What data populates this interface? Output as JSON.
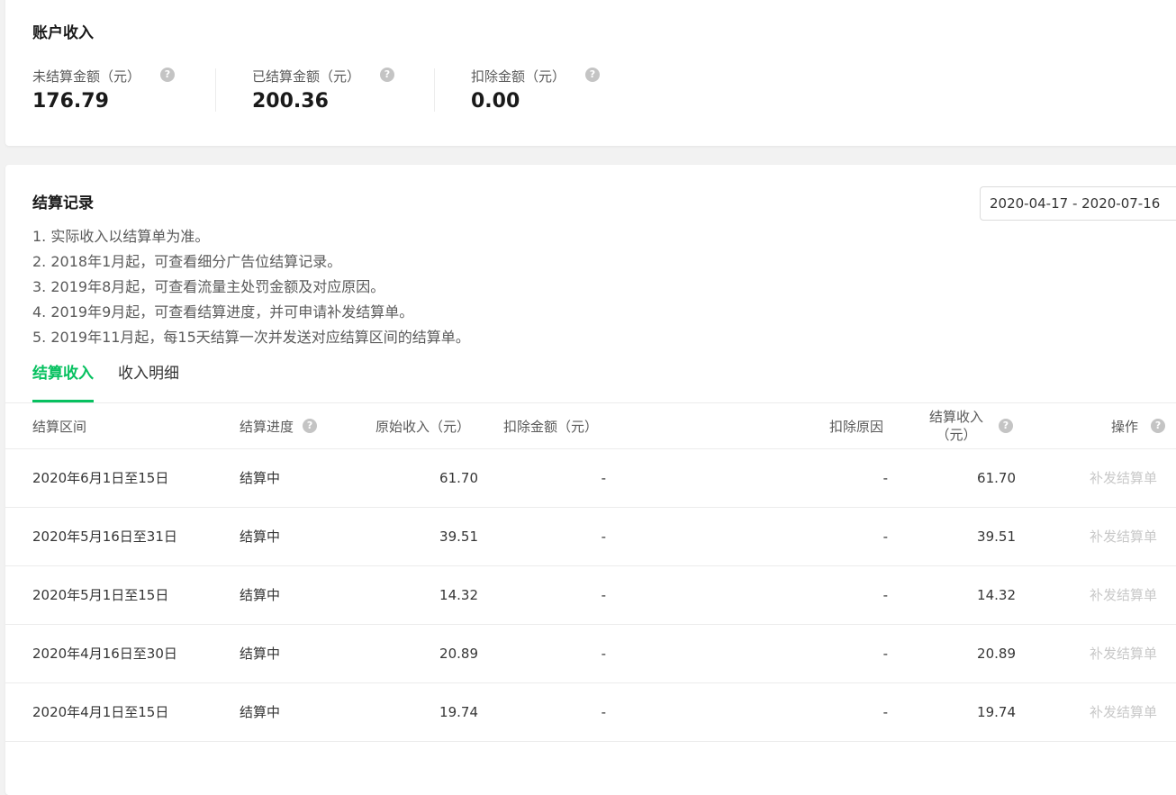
{
  "account": {
    "title": "账户收入",
    "metrics": [
      {
        "label": "未结算金额（元）",
        "value": "176.79"
      },
      {
        "label": "已结算金额（元）",
        "value": "200.36"
      },
      {
        "label": "扣除金额（元）",
        "value": "0.00"
      }
    ]
  },
  "settlement": {
    "title": "结算记录",
    "date_range": "2020-04-17 - 2020-07-16",
    "notes": [
      "1. 实际收入以结算单为准。",
      "2. 2018年1月起，可查看细分广告位结算记录。",
      "3. 2019年8月起，可查看流量主处罚金额及对应原因。",
      "4. 2019年9月起，可查看结算进度，并可申请补发结算单。",
      "5. 2019年11月起，每15天结算一次并发送对应结算区间的结算单。"
    ],
    "tabs": [
      {
        "label": "结算收入",
        "active": true
      },
      {
        "label": "收入明细",
        "active": false
      }
    ],
    "columns": {
      "period": "结算区间",
      "progress": "结算进度",
      "original": "原始收入（元）",
      "deduction": "扣除金额（元）",
      "reason": "扣除原因",
      "income_line1": "结算收入",
      "income_line2": "（元）",
      "action": "操作"
    },
    "rows": [
      {
        "period": "2020年6月1日至15日",
        "progress": "结算中",
        "original": "61.70",
        "deduction": "-",
        "reason": "-",
        "income": "61.70",
        "action": "补发结算单"
      },
      {
        "period": "2020年5月16日至31日",
        "progress": "结算中",
        "original": "39.51",
        "deduction": "-",
        "reason": "-",
        "income": "39.51",
        "action": "补发结算单"
      },
      {
        "period": "2020年5月1日至15日",
        "progress": "结算中",
        "original": "14.32",
        "deduction": "-",
        "reason": "-",
        "income": "14.32",
        "action": "补发结算单"
      },
      {
        "period": "2020年4月16日至30日",
        "progress": "结算中",
        "original": "20.89",
        "deduction": "-",
        "reason": "-",
        "income": "20.89",
        "action": "补发结算单"
      },
      {
        "period": "2020年4月1日至15日",
        "progress": "结算中",
        "original": "19.74",
        "deduction": "-",
        "reason": "-",
        "income": "19.74",
        "action": "补发结算单"
      }
    ]
  },
  "icons": {
    "help": "question-circle-icon",
    "help_glyph": "?"
  },
  "colors": {
    "accent": "#07c160",
    "disabled_text": "#c8c8c8",
    "background": "#f2f2f2"
  }
}
